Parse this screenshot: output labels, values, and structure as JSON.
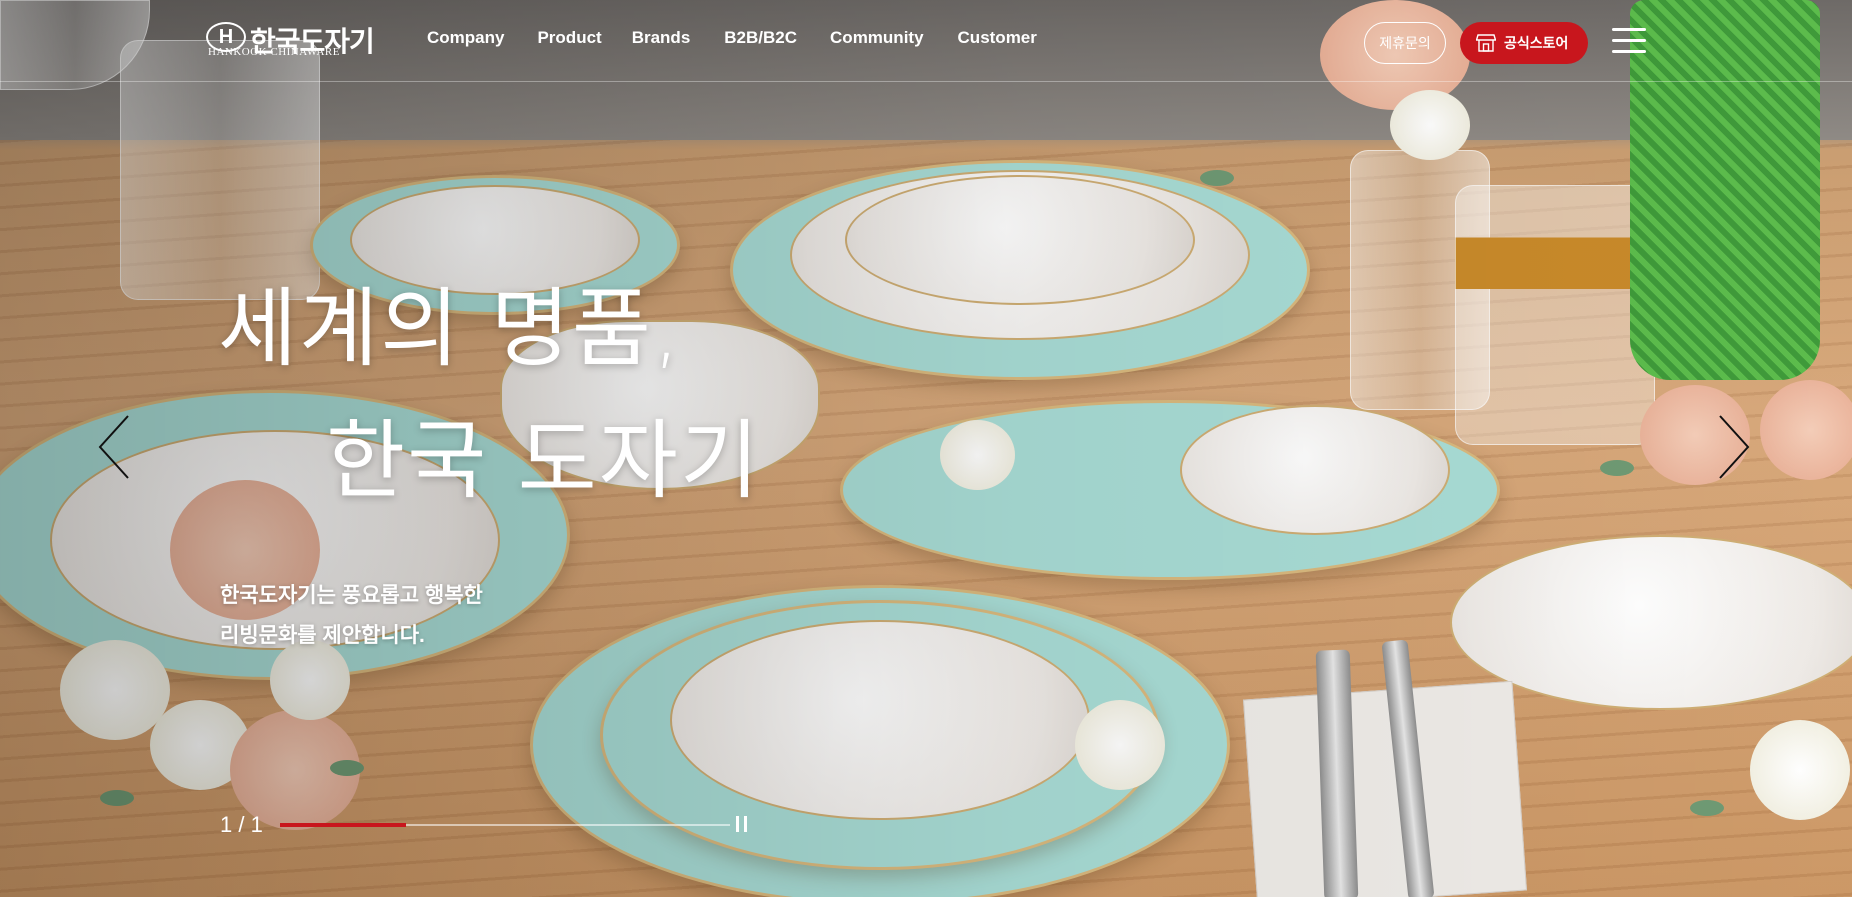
{
  "header": {
    "logo": {
      "mark": "H",
      "name_ko": "한국도자기",
      "name_en": "HANKOOK CHINAWARE"
    },
    "nav": [
      "Company",
      "Product",
      "Brands",
      "B2B/B2C",
      "Community",
      "Customer"
    ],
    "inquiry_label": "제휴문의",
    "store_label": "공식스토어",
    "store_icon": "storefront-icon",
    "menu_icon": "hamburger-menu-icon"
  },
  "hero": {
    "headline_line1": "세계의 명품,",
    "headline_line2": "한국 도자기",
    "subcopy_line1": "한국도자기는 풍요롭고 행복한",
    "subcopy_line2": "리빙문화를 제안합니다.",
    "prev_icon": "chevron-left-icon",
    "next_icon": "chevron-right-icon",
    "background_image": "table-setting-photo"
  },
  "slider": {
    "pagination": "1 / 1",
    "progress": 0.28,
    "pause_icon": "pause-icon"
  },
  "colors": {
    "accent": "#c8161d",
    "text": "#ffffff"
  }
}
